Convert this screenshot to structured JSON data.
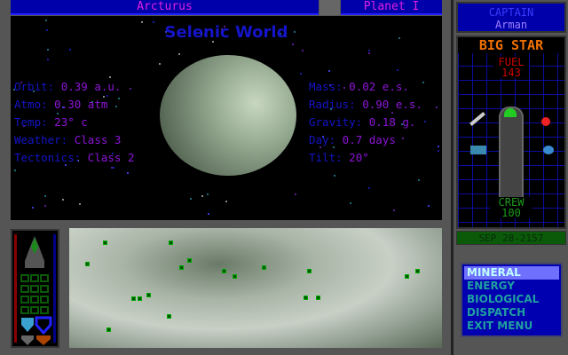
{
  "header": {
    "system": "Arcturus",
    "planet": "Planet I"
  },
  "planet": {
    "type": "Selenic World",
    "left_stats": [
      {
        "label": "Orbit:",
        "value": "0.39 a.u."
      },
      {
        "label": "Atmo:",
        "value": "0.30 atm"
      },
      {
        "label": "Temp:",
        "value": "23° c"
      },
      {
        "label": "Weather:",
        "value": "Class 3"
      },
      {
        "label": "Tectonics:",
        "value": "Class 2"
      }
    ],
    "right_stats": [
      {
        "label": "Mass:",
        "value": "0.02 e.s."
      },
      {
        "label": "Radius:",
        "value": "0.90 e.s."
      },
      {
        "label": "Gravity:",
        "value": "0.18 g."
      },
      {
        "label": "Day:",
        "value": "0.7 days"
      },
      {
        "label": "Tilt:",
        "value": "20°"
      }
    ]
  },
  "captain": {
    "title": "CAPTAIN",
    "name": "Arman"
  },
  "ship": {
    "name": "BIG STAR",
    "fuel_label": "FUEL",
    "fuel": "143",
    "crew_label": "CREW",
    "crew": "100"
  },
  "date": "SEP 28-2157",
  "menu": [
    "MINERAL",
    "ENERGY",
    "BIOLOGICAL",
    "DISPATCH",
    "EXIT MENU"
  ],
  "colors": {
    "title_bar": "#0000aa",
    "menu_selected": "#7070ff"
  }
}
